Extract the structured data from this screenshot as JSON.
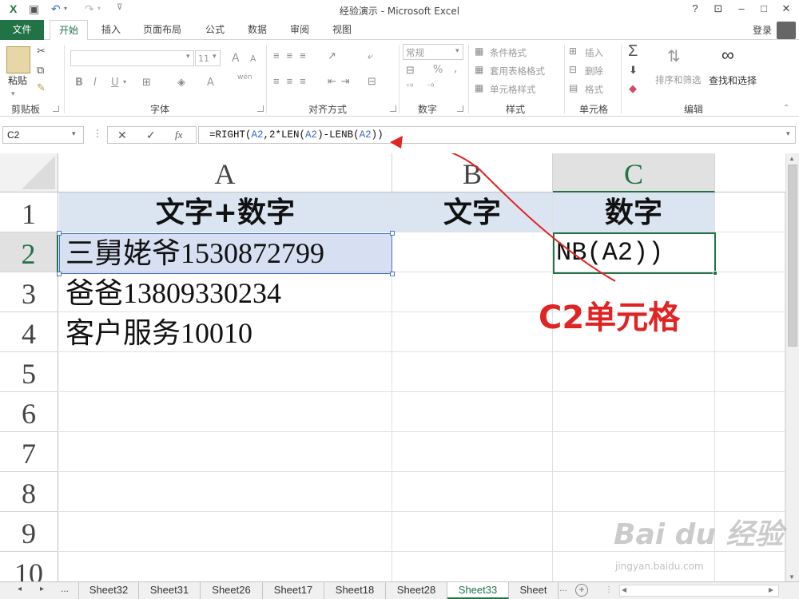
{
  "window": {
    "title": "经验演示 - Microsoft Excel",
    "help": "?",
    "login": "登录"
  },
  "tabs": {
    "file": "文件",
    "items": [
      "开始",
      "插入",
      "页面布局",
      "公式",
      "数据",
      "审阅",
      "视图"
    ],
    "active": "开始"
  },
  "ribbon": {
    "clipboard": {
      "paste": "粘贴",
      "label": "剪贴板"
    },
    "font": {
      "size": "11",
      "bold": "B",
      "italic": "I",
      "underline": "U",
      "grow": "A",
      "shrink": "A",
      "color": "A",
      "wen": "wén",
      "label": "字体"
    },
    "alignment": {
      "label": "对齐方式"
    },
    "number": {
      "format": "常规",
      "percent": "%",
      "comma": ",",
      "label": "数字"
    },
    "styles": {
      "conditional": "条件格式",
      "table": "套用表格格式",
      "cell": "单元格样式",
      "label": "样式"
    },
    "cells": {
      "insert": "插入",
      "delete": "删除",
      "format": "格式",
      "label": "单元格"
    },
    "editing": {
      "sort": "排序和筛选",
      "find": "查找和选择",
      "label": "编辑"
    }
  },
  "formula_bar": {
    "name_box": "C2",
    "cancel": "✕",
    "confirm": "✓",
    "fx": "fx",
    "formula_parts": {
      "p1": "=RIGHT(",
      "r1": "A2",
      "p2": ",2*LEN(",
      "r2": "A2",
      "p3": ")-LENB(",
      "r3": "A2",
      "p4": "))"
    }
  },
  "grid": {
    "columns": [
      "A",
      "B",
      "C"
    ],
    "rows": [
      "1",
      "2",
      "3",
      "4",
      "5",
      "6",
      "7",
      "8",
      "9",
      "10"
    ],
    "header_row": [
      "文字+数字",
      "文字",
      "数字"
    ],
    "data": [
      {
        "a_zh": "三舅姥爷",
        "a_num": "1530872799",
        "b": "",
        "c": "NB(A2))"
      },
      {
        "a_zh": "爸爸",
        "a_num": "13809330234",
        "b": "",
        "c": ""
      },
      {
        "a_zh": "客户服务",
        "a_num": "10010",
        "b": "",
        "c": ""
      }
    ]
  },
  "annotation": {
    "text": "C2单元格",
    "color": "#e02424"
  },
  "sheets": {
    "more": "...",
    "tabs": [
      "Sheet32",
      "Sheet31",
      "Sheet26",
      "Sheet17",
      "Sheet18",
      "Sheet28",
      "Sheet33",
      "Sheet"
    ],
    "active": "Sheet33",
    "add": "+"
  },
  "watermark": {
    "main": "Bai du 经验",
    "sub": "jingyan.baidu.com"
  },
  "colors": {
    "excel_green": "#217346",
    "selection_blue": "#4472c4",
    "header_fill": "#dbe5f1"
  }
}
